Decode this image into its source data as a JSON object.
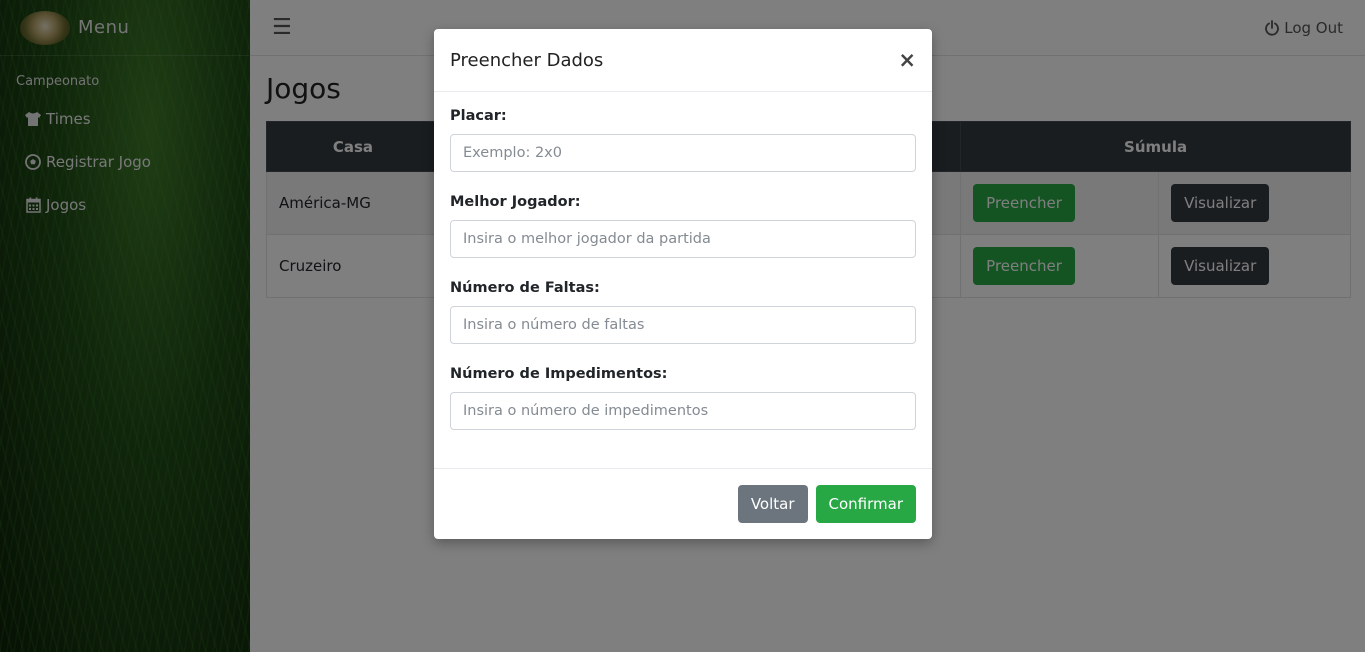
{
  "sidebar": {
    "brand": "Menu",
    "section_label": "Campeonato",
    "items": [
      {
        "label": "Times",
        "icon": "shirt-icon"
      },
      {
        "label": "Registrar Jogo",
        "icon": "soccer-ball-icon"
      },
      {
        "label": "Jogos",
        "icon": "calendar-icon"
      }
    ]
  },
  "topbar": {
    "menu_icon": "hamburger-icon",
    "logout_label": "Log Out",
    "logout_icon": "power-icon"
  },
  "page": {
    "title": "Jogos"
  },
  "table": {
    "headers": [
      "Casa",
      "",
      "Súmula"
    ],
    "rows": [
      {
        "home": "América-MG",
        "fill_label": "Preencher",
        "view_label": "Visualizar"
      },
      {
        "home": "Cruzeiro",
        "fill_label": "Preencher",
        "view_label": "Visualizar"
      }
    ]
  },
  "modal": {
    "title": "Preencher Dados",
    "close": "×",
    "fields": [
      {
        "label": "Placar:",
        "placeholder": "Exemplo: 2x0"
      },
      {
        "label": "Melhor Jogador:",
        "placeholder": "Insira o melhor jogador da partida"
      },
      {
        "label": "Número de Faltas:",
        "placeholder": "Insira o número de faltas"
      },
      {
        "label": "Número de Impedimentos:",
        "placeholder": "Insira o número de impedimentos"
      }
    ],
    "back_label": "Voltar",
    "confirm_label": "Confirmar"
  },
  "colors": {
    "success": "#28a745",
    "dark": "#343a40",
    "secondary": "#6c757d"
  }
}
